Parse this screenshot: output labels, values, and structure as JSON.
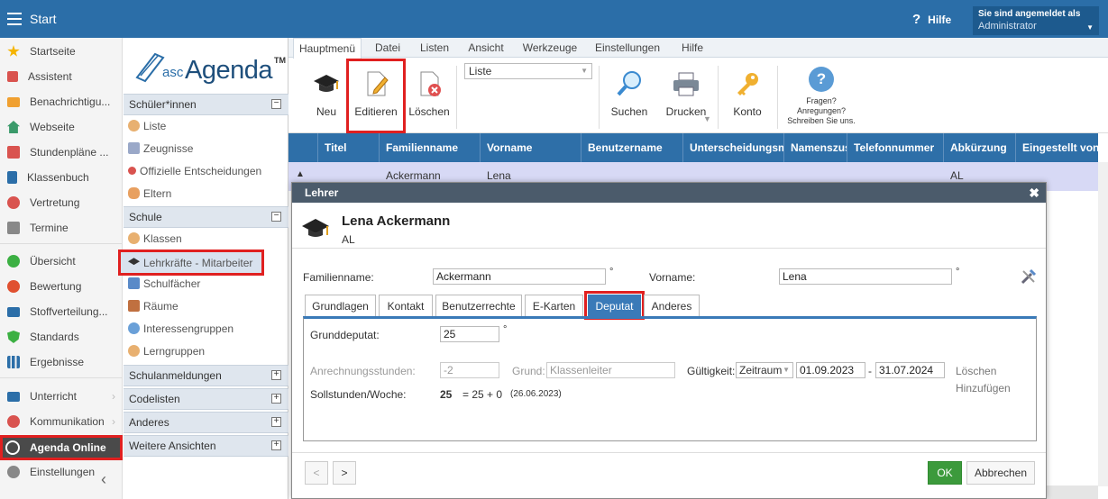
{
  "topbar": {
    "title": "Start",
    "help": "Hilfe",
    "login_line1": "Sie sind angemeldet als",
    "login_user": "Administrator"
  },
  "leftnav": [
    {
      "label": "Startseite",
      "color": "#f5b400"
    },
    {
      "label": "Assistent",
      "color": "#d9534f"
    },
    {
      "label": "Benachrichtigu...",
      "color": "#f0a030"
    },
    {
      "label": "Webseite",
      "color": "#3a9a6a"
    },
    {
      "label": "Stundenpläne ...",
      "color": "#d9534f"
    },
    {
      "label": "Klassenbuch",
      "color": "#2b6ea8"
    },
    {
      "label": "Vertretung",
      "color": "#d9534f"
    },
    {
      "label": "Termine",
      "color": "#888888"
    },
    {
      "label": "Übersicht",
      "color": "#3cb043"
    },
    {
      "label": "Bewertung",
      "color": "#e05030"
    },
    {
      "label": "Stoffverteilung...",
      "color": "#2b6ea8"
    },
    {
      "label": "Standards",
      "color": "#3cb043"
    },
    {
      "label": "Ergebnisse",
      "color": "#2b6ea8"
    },
    {
      "label": "Unterricht",
      "color": "#2b6ea8"
    },
    {
      "label": "Kommunikation",
      "color": "#d9534f"
    },
    {
      "label": "Agenda Online",
      "color": "#ffffff"
    },
    {
      "label": "Einstellungen",
      "color": "#888888"
    }
  ],
  "logo": {
    "prefix": "asc",
    "name": "Agenda",
    "tm": "TM"
  },
  "midpanel": {
    "sec1": "Schüler*innen",
    "sec1_items": [
      "Liste",
      "Zeugnisse",
      "Offizielle Entscheidungen",
      "Eltern"
    ],
    "sec2": "Schule",
    "sec2_items": [
      "Klassen",
      "Lehrkräfte - Mitarbeiter",
      "Schulfächer",
      "Räume",
      "Interessengruppen",
      "Lerngruppen"
    ],
    "sec3": "Schulanmeldungen",
    "sec4": "Codelisten",
    "sec5": "Anderes",
    "sec6": "Weitere Ansichten"
  },
  "menutabs": [
    "Hauptmenü",
    "Datei",
    "Listen",
    "Ansicht",
    "Werkzeuge",
    "Einstellungen",
    "Hilfe"
  ],
  "toolbar": {
    "neu": "Neu",
    "editieren": "Editieren",
    "loeschen": "Löschen",
    "select": "Liste",
    "suchen": "Suchen",
    "drucken": "Drucken",
    "konto": "Konto",
    "fragen1": "Fragen?",
    "fragen2": "Anregungen?",
    "fragen3": "Schreiben Sie uns."
  },
  "grid": {
    "headers": [
      "Titel",
      "Familienname",
      "Vorname",
      "Benutzername",
      "Unterscheidungsm",
      "Namenszus",
      "Telefonnummer",
      "Abkürzung",
      "Eingestellt von"
    ],
    "row": {
      "familienname": "Ackermann",
      "vorname": "Lena",
      "abk": "AL"
    }
  },
  "dialog": {
    "title": "Lehrer",
    "name": "Lena Ackermann",
    "abbr": "AL",
    "familienname_label": "Familienname:",
    "familienname": "Ackermann",
    "vorname_label": "Vorname:",
    "vorname": "Lena",
    "deg": "°",
    "tabs": [
      "Grundlagen",
      "Kontakt",
      "Benutzerrechte",
      "E-Karten",
      "Deputat",
      "Anderes"
    ],
    "grunddeputat_label": "Grunddeputat:",
    "grunddeputat": "25",
    "anrechnung_label": "Anrechnungsstunden:",
    "anrechnung": "-2",
    "grund_label": "Grund:",
    "grund": "Klassenleiter",
    "gueltig_label": "Gültigkeit:",
    "zeitraum": "Zeitraum",
    "von": "01.09.2023",
    "dash": "-",
    "bis": "31.07.2024",
    "loeschen": "Löschen",
    "hinzufuegen": "Hinzufügen",
    "soll_label": "Sollstunden/Woche:",
    "soll_val": "25",
    "soll_formula": "= 25 + 0",
    "soll_date": "(26.06.2023)",
    "prev": "<",
    "next": ">",
    "ok": "OK",
    "abbrechen": "Abbrechen"
  }
}
